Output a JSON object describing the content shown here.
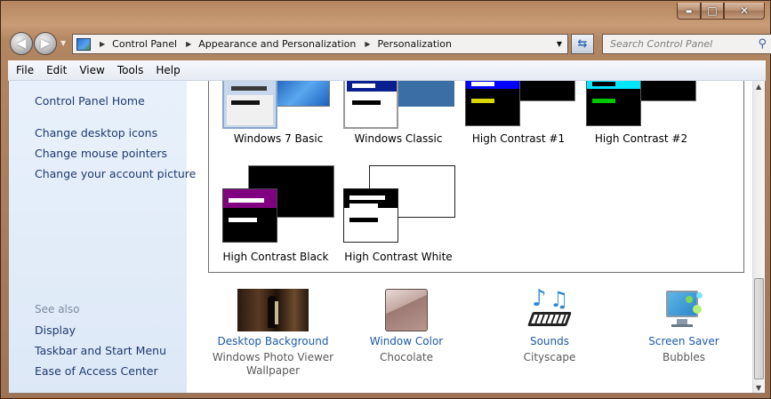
{
  "window": {
    "buttons": {
      "minimize": "▬",
      "maximize": "□",
      "close": "✕"
    }
  },
  "nav": {
    "breadcrumb": [
      "Control Panel",
      "Appearance and Personalization",
      "Personalization"
    ],
    "search_placeholder": "Search Control Panel"
  },
  "menubar": [
    "File",
    "Edit",
    "View",
    "Tools",
    "Help"
  ],
  "sidebar": {
    "home": "Control Panel Home",
    "links": [
      "Change desktop icons",
      "Change mouse pointers",
      "Change your account picture"
    ],
    "see_also_heading": "See also",
    "see_also": [
      "Display",
      "Taskbar and Start Menu",
      "Ease of Access Center"
    ]
  },
  "themes": [
    {
      "label": "Windows 7 Basic",
      "back_color": "#3f86d8",
      "front_color": "#c9d7ea",
      "title_bar": "#e8eef7",
      "bar_colors": [
        "#3a3a3a",
        "#111111"
      ]
    },
    {
      "label": "Windows Classic",
      "back_color": "#3a6ea5",
      "front_color": "#ffffff",
      "title_bar": "#0a1f8f",
      "bar_colors": [
        "#ffffff",
        "#000000"
      ]
    },
    {
      "label": "High Contrast #1",
      "back_color": "#000000",
      "front_color": "#000000",
      "title_bar": "#0000ff",
      "bar_colors": [
        "#ffffff",
        "#d8d800"
      ]
    },
    {
      "label": "High Contrast #2",
      "back_color": "#000000",
      "front_color": "#000000",
      "title_bar": "#00e6ff",
      "bar_colors": [
        "#000000",
        "#00c800"
      ]
    },
    {
      "label": "High Contrast Black",
      "back_color": "#000000",
      "front_color": "#000000",
      "title_bar": "#800080",
      "bar_colors": [
        "#ffffff",
        "#ffffff"
      ]
    },
    {
      "label": "High Contrast White",
      "back_color": "#ffffff",
      "front_color": "#ffffff",
      "title_bar": "#000000",
      "bar_colors": [
        "#ffffff",
        "#000000"
      ]
    }
  ],
  "tiles": [
    {
      "link": "Desktop Background",
      "sub": "Windows Photo Viewer Wallpaper",
      "icon": "desktop-background-thumbnail"
    },
    {
      "link": "Window Color",
      "sub": "Chocolate",
      "icon": "window-color-swatch"
    },
    {
      "link": "Sounds",
      "sub": "Cityscape",
      "icon": "sounds-icon"
    },
    {
      "link": "Screen Saver",
      "sub": "Bubbles",
      "icon": "screen-saver-icon"
    }
  ]
}
